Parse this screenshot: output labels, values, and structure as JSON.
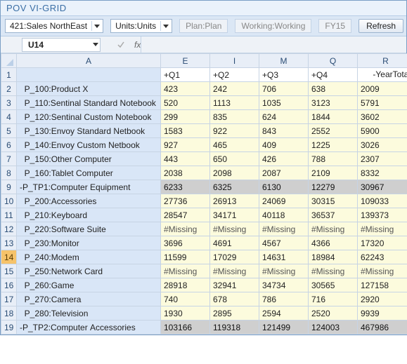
{
  "window": {
    "title": "POV VI-GRID"
  },
  "toolbar": {
    "entity": "421:Sales NorthEast",
    "units": "Units:Units",
    "plan": "Plan:Plan",
    "working": "Working:Working",
    "year": "FY15",
    "refresh_label": "Refresh"
  },
  "namebox": {
    "ref": "U14",
    "fx_label": "fx"
  },
  "columns": {
    "letters": {
      "A": "A",
      "E": "E",
      "I": "I",
      "M": "M",
      "Q": "Q",
      "R": "R"
    },
    "periods": {
      "q1": "+Q1",
      "q2": "+Q2",
      "q3": "+Q3",
      "q4": "+Q4",
      "year": "-YearTotal"
    }
  },
  "row_labels": [
    "1",
    "2",
    "3",
    "4",
    "5",
    "6",
    "7",
    "8",
    "9",
    "10",
    "11",
    "12",
    "13",
    "14",
    "15",
    "16",
    "17",
    "18",
    "19"
  ],
  "rows": [
    {
      "a": "  P_100:Product X",
      "e": "423",
      "i": "242",
      "m": "706",
      "q": "638",
      "r": "2009"
    },
    {
      "a": "  P_110:Sentinal Standard Notebook",
      "e": "520",
      "i": "1113",
      "m": "1035",
      "q": "3123",
      "r": "5791"
    },
    {
      "a": "  P_120:Sentinal Custom Notebook",
      "e": "299",
      "i": "835",
      "m": "624",
      "q": "1844",
      "r": "3602"
    },
    {
      "a": "  P_130:Envoy Standard Netbook",
      "e": "1583",
      "i": "922",
      "m": "843",
      "q": "2552",
      "r": "5900"
    },
    {
      "a": "  P_140:Envoy Custom Netbook",
      "e": "927",
      "i": "465",
      "m": "409",
      "q": "1225",
      "r": "3026"
    },
    {
      "a": "  P_150:Other Computer",
      "e": "443",
      "i": "650",
      "m": "426",
      "q": "788",
      "r": "2307"
    },
    {
      "a": "  P_160:Tablet Computer",
      "e": "2038",
      "i": "2098",
      "m": "2087",
      "q": "2109",
      "r": "8332"
    },
    {
      "a": "-P_TP1:Computer Equipment",
      "e": "6233",
      "i": "6325",
      "m": "6130",
      "q": "12279",
      "r": "30967",
      "total": true
    },
    {
      "a": "  P_200:Accessories",
      "e": "27736",
      "i": "26913",
      "m": "24069",
      "q": "30315",
      "r": "109033"
    },
    {
      "a": "  P_210:Keyboard",
      "e": "28547",
      "i": "34171",
      "m": "40118",
      "q": "36537",
      "r": "139373"
    },
    {
      "a": "  P_220:Software Suite",
      "e": "#Missing",
      "i": "#Missing",
      "m": "#Missing",
      "q": "#Missing",
      "r": "#Missing",
      "miss": true
    },
    {
      "a": "  P_230:Monitor",
      "e": "3696",
      "i": "4691",
      "m": "4567",
      "q": "4366",
      "r": "17320"
    },
    {
      "a": "  P_240:Modem",
      "e": "11599",
      "i": "17029",
      "m": "14631",
      "q": "18984",
      "r": "62243",
      "active": true
    },
    {
      "a": "  P_250:Network Card",
      "e": "#Missing",
      "i": "#Missing",
      "m": "#Missing",
      "q": "#Missing",
      "r": "#Missing",
      "miss": true
    },
    {
      "a": "  P_260:Game",
      "e": "28918",
      "i": "32941",
      "m": "34734",
      "q": "30565",
      "r": "127158"
    },
    {
      "a": "  P_270:Camera",
      "e": "740",
      "i": "678",
      "m": "786",
      "q": "716",
      "r": "2920"
    },
    {
      "a": "  P_280:Television",
      "e": "1930",
      "i": "2895",
      "m": "2594",
      "q": "2520",
      "r": "9939"
    },
    {
      "a": "-P_TP2:Computer Accessories",
      "e": "103166",
      "i": "119318",
      "m": "121499",
      "q": "124003",
      "r": "467986",
      "total": true
    }
  ]
}
